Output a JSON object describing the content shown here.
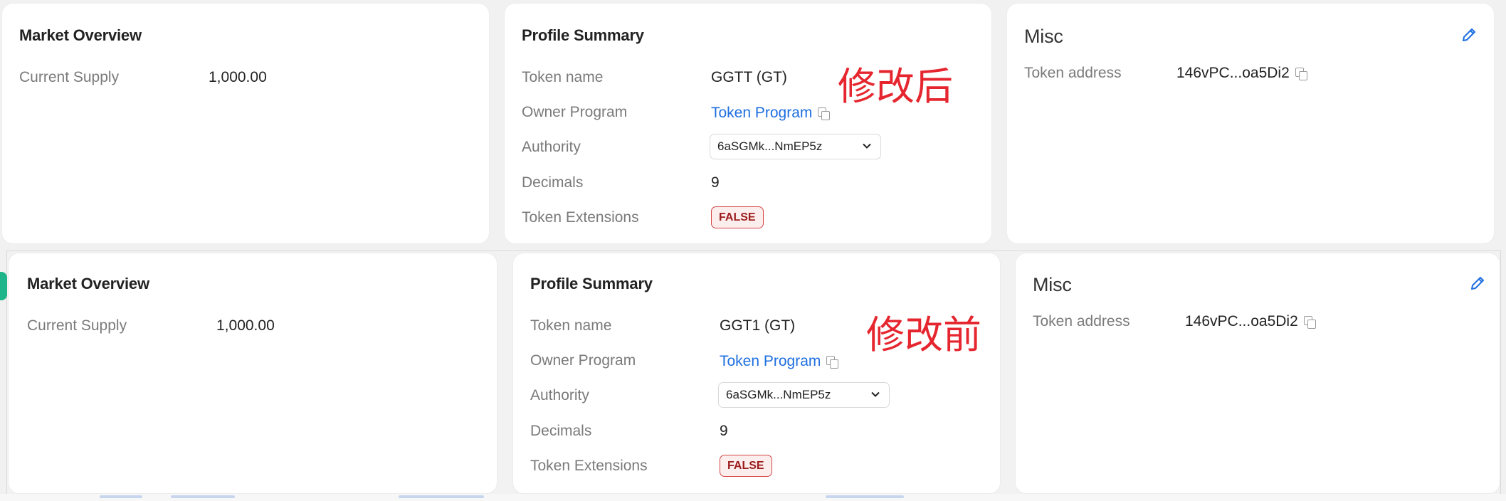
{
  "panels": {
    "after": {
      "annotation": "修改后",
      "market": {
        "title": "Market Overview",
        "current_supply_label": "Current Supply",
        "current_supply_value": "1,000.00"
      },
      "profile": {
        "title": "Profile Summary",
        "token_name_label": "Token name",
        "token_name_value": "GGTT (GT)",
        "owner_program_label": "Owner Program",
        "owner_program_value": "Token Program",
        "authority_label": "Authority",
        "authority_value": "6aSGMk...NmEP5z",
        "decimals_label": "Decimals",
        "decimals_value": "9",
        "token_extensions_label": "Token Extensions",
        "token_extensions_value": "FALSE"
      },
      "misc": {
        "title": "Misc",
        "token_address_label": "Token address",
        "token_address_value": "146vPC...oa5Di2"
      }
    },
    "before": {
      "annotation": "修改前",
      "market": {
        "title": "Market Overview",
        "current_supply_label": "Current Supply",
        "current_supply_value": "1,000.00"
      },
      "profile": {
        "title": "Profile Summary",
        "token_name_label": "Token name",
        "token_name_value": "GGT1 (GT)",
        "owner_program_label": "Owner Program",
        "owner_program_value": "Token Program",
        "authority_label": "Authority",
        "authority_value": "6aSGMk...NmEP5z",
        "decimals_label": "Decimals",
        "decimals_value": "9",
        "token_extensions_label": "Token Extensions",
        "token_extensions_value": "FALSE"
      },
      "misc": {
        "title": "Misc",
        "token_address_label": "Token address",
        "token_address_value": "146vPC...oa5Di2"
      }
    }
  },
  "icons": {
    "copy": "copy-icon",
    "chevron": "chevron-down-icon",
    "edit": "pencil-icon"
  },
  "colors": {
    "link": "#1f6fe0",
    "annotation": "#e6262f",
    "badge_border": "#d64545",
    "badge_bg": "#fdeeee",
    "badge_text": "#9c1b1b"
  }
}
